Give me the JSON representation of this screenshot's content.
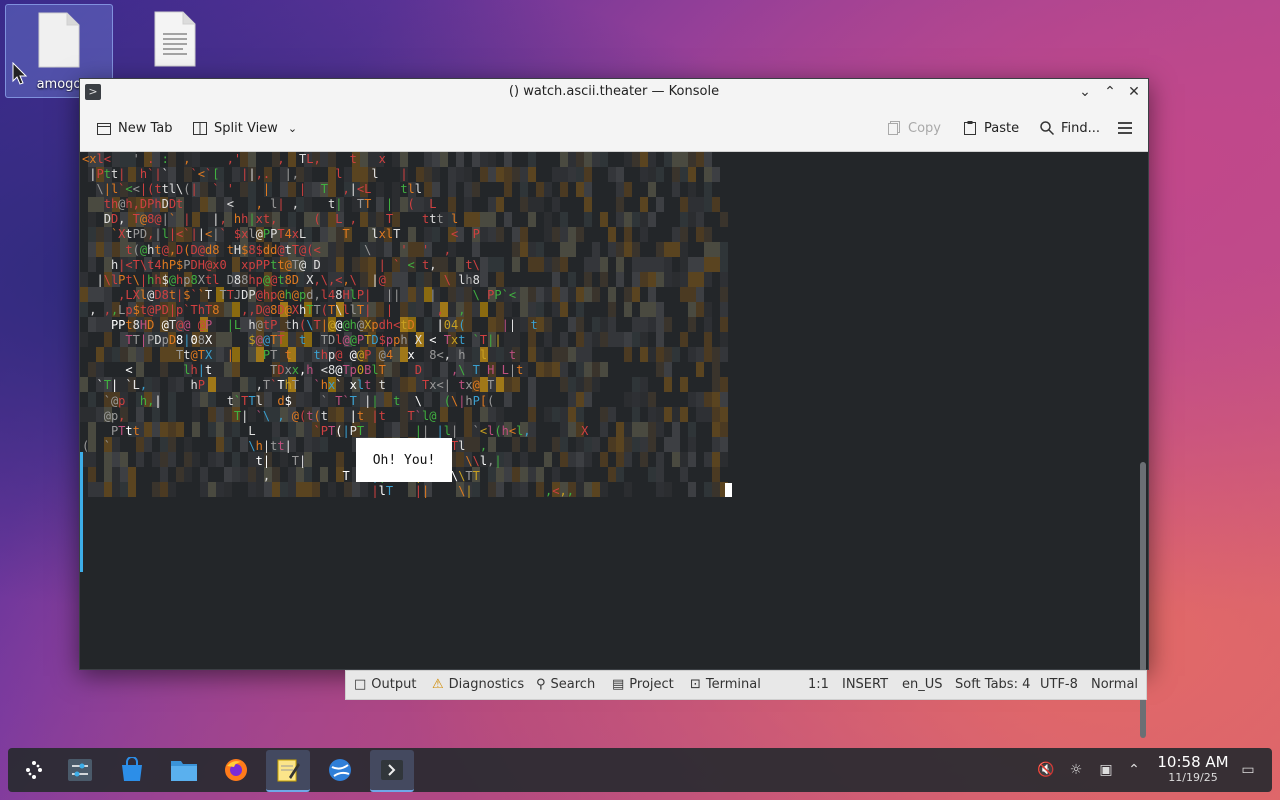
{
  "desktop": {
    "icons": [
      {
        "label": "amogo",
        "selected": true
      },
      {
        "label": "",
        "selected": false
      }
    ]
  },
  "window": {
    "title": "() watch.ascii.theater — Konsole",
    "toolbar": {
      "new_tab": "New Tab",
      "split_view": "Split View",
      "copy": "Copy",
      "paste": "Paste",
      "find": "Find..."
    }
  },
  "terminal": {
    "lines": [
      "<xl<   ' . :  ,     ,'     ,  TL,    t   x     ",
      " |Ptt|  h`|`   `<`[   ||,.  |,     l    l   |   ",
      "  \\|l`<<|(ttl\\(|  ` '    |    |  T  ,|<L    tll  ",
      "   th@h,DPhDDt      <   , l| ,    t|  TT  |  (  L",
      "   DD, T@8@|` |   |, hh|xt,     (  L ,    T    ttt l",
      "    `XtPD,|l|<`||<|` $xl@PPT4xL     T   lxlT       <  P",
      "      t(@ht@,D(D@d8 tH$8$dd@tT@(<      \\    '  '  ,",
      "    h|<T\\t4hP$PDH@x0  xpPPtt@T@ D        | ` < t,    t\\",
      "  |\\lPt\\|hh$@hp8Xtl D88hp@@t8D X,\\,<,\\  |@        \\ lh8",
      "     ,LXl@D8t|$``T TTJDP@hp@h@pd,l48HlP|  ||    |     \\ PP`<",
      " , ,,Lp$t@PD|p`ThT8   ,,D@8D@XhTT(T\\llT|  |      ,  ,      ",
      "    PPt8HD @T@@ @P  |L h@tP_th(\\T|@@@h@Xpdh<tD   |04(     ||  t ",
      "      TT|PDpD8|08X     $@@TT  t  TDl@@PTD$pph X < Txt `T||  ",
      "             Tt@TX  |    PT t   thp@ @@P @4  x  8<, h  l   t",
      "      <       lh|t        TDxx,h <8@Tp0BlT    D    ,\\ T H L|t",
      "  `T| `L,      hP       ,T`ThT  `hx` xlt t     Tx<| tx@ T",
      "   `@p  h,|         t`TTl  d$    ` T`T ||  t  \\   (\\|hP[(",
      "   @p,               T| `\\ , @(t(t   |t |t   T`l@",
      "    PTtt               L        `PT(|PT       || |l|  `<l(h<l,       X",
      "(  `                   \\h|tt|            |    ,t`tTTl  ,",
      "                        t|   T|          |     l     \\\\l,|",
      "                         ,          T   ||hh  |    \\\\TT",
      "                                        |lT   ||    \\|          ,<,,"
    ],
    "popup_text": "Oh! You!"
  },
  "statusbar": {
    "output": "Output",
    "diagnostics": "Diagnostics",
    "search": "Search",
    "project": "Project",
    "terminal": "Terminal",
    "position": "1:1",
    "mode": "INSERT",
    "language": "en_US",
    "tabs": "Soft Tabs: 4",
    "encoding": "UTF-8",
    "view_mode": "Normal"
  },
  "taskbar": {
    "clock_time": "10:58 AM",
    "clock_date": "11/19/25"
  }
}
